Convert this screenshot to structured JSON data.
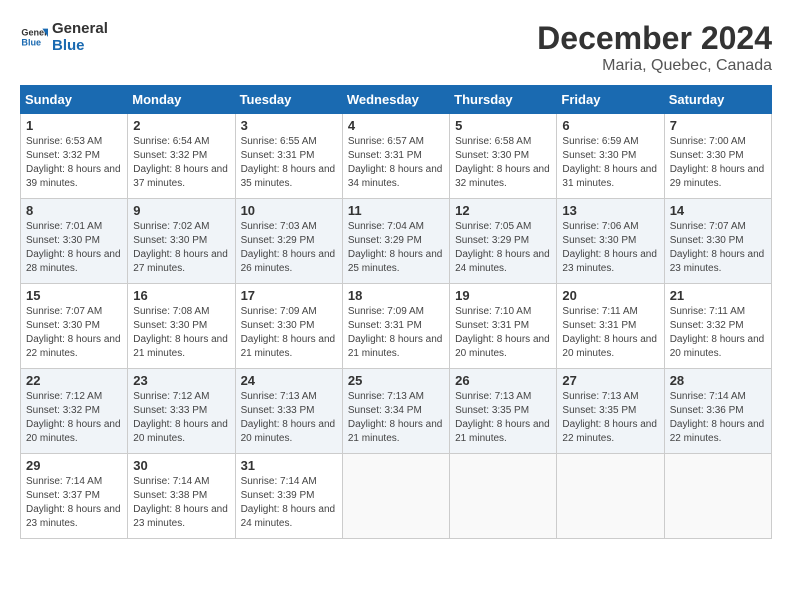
{
  "header": {
    "logo_general": "General",
    "logo_blue": "Blue",
    "month": "December 2024",
    "location": "Maria, Quebec, Canada"
  },
  "days_of_week": [
    "Sunday",
    "Monday",
    "Tuesday",
    "Wednesday",
    "Thursday",
    "Friday",
    "Saturday"
  ],
  "weeks": [
    [
      {
        "day": "1",
        "sunrise": "6:53 AM",
        "sunset": "3:32 PM",
        "daylight": "8 hours and 39 minutes."
      },
      {
        "day": "2",
        "sunrise": "6:54 AM",
        "sunset": "3:32 PM",
        "daylight": "8 hours and 37 minutes."
      },
      {
        "day": "3",
        "sunrise": "6:55 AM",
        "sunset": "3:31 PM",
        "daylight": "8 hours and 35 minutes."
      },
      {
        "day": "4",
        "sunrise": "6:57 AM",
        "sunset": "3:31 PM",
        "daylight": "8 hours and 34 minutes."
      },
      {
        "day": "5",
        "sunrise": "6:58 AM",
        "sunset": "3:30 PM",
        "daylight": "8 hours and 32 minutes."
      },
      {
        "day": "6",
        "sunrise": "6:59 AM",
        "sunset": "3:30 PM",
        "daylight": "8 hours and 31 minutes."
      },
      {
        "day": "7",
        "sunrise": "7:00 AM",
        "sunset": "3:30 PM",
        "daylight": "8 hours and 29 minutes."
      }
    ],
    [
      {
        "day": "8",
        "sunrise": "7:01 AM",
        "sunset": "3:30 PM",
        "daylight": "8 hours and 28 minutes."
      },
      {
        "day": "9",
        "sunrise": "7:02 AM",
        "sunset": "3:30 PM",
        "daylight": "8 hours and 27 minutes."
      },
      {
        "day": "10",
        "sunrise": "7:03 AM",
        "sunset": "3:29 PM",
        "daylight": "8 hours and 26 minutes."
      },
      {
        "day": "11",
        "sunrise": "7:04 AM",
        "sunset": "3:29 PM",
        "daylight": "8 hours and 25 minutes."
      },
      {
        "day": "12",
        "sunrise": "7:05 AM",
        "sunset": "3:29 PM",
        "daylight": "8 hours and 24 minutes."
      },
      {
        "day": "13",
        "sunrise": "7:06 AM",
        "sunset": "3:30 PM",
        "daylight": "8 hours and 23 minutes."
      },
      {
        "day": "14",
        "sunrise": "7:07 AM",
        "sunset": "3:30 PM",
        "daylight": "8 hours and 23 minutes."
      }
    ],
    [
      {
        "day": "15",
        "sunrise": "7:07 AM",
        "sunset": "3:30 PM",
        "daylight": "8 hours and 22 minutes."
      },
      {
        "day": "16",
        "sunrise": "7:08 AM",
        "sunset": "3:30 PM",
        "daylight": "8 hours and 21 minutes."
      },
      {
        "day": "17",
        "sunrise": "7:09 AM",
        "sunset": "3:30 PM",
        "daylight": "8 hours and 21 minutes."
      },
      {
        "day": "18",
        "sunrise": "7:09 AM",
        "sunset": "3:31 PM",
        "daylight": "8 hours and 21 minutes."
      },
      {
        "day": "19",
        "sunrise": "7:10 AM",
        "sunset": "3:31 PM",
        "daylight": "8 hours and 20 minutes."
      },
      {
        "day": "20",
        "sunrise": "7:11 AM",
        "sunset": "3:31 PM",
        "daylight": "8 hours and 20 minutes."
      },
      {
        "day": "21",
        "sunrise": "7:11 AM",
        "sunset": "3:32 PM",
        "daylight": "8 hours and 20 minutes."
      }
    ],
    [
      {
        "day": "22",
        "sunrise": "7:12 AM",
        "sunset": "3:32 PM",
        "daylight": "8 hours and 20 minutes."
      },
      {
        "day": "23",
        "sunrise": "7:12 AM",
        "sunset": "3:33 PM",
        "daylight": "8 hours and 20 minutes."
      },
      {
        "day": "24",
        "sunrise": "7:13 AM",
        "sunset": "3:33 PM",
        "daylight": "8 hours and 20 minutes."
      },
      {
        "day": "25",
        "sunrise": "7:13 AM",
        "sunset": "3:34 PM",
        "daylight": "8 hours and 21 minutes."
      },
      {
        "day": "26",
        "sunrise": "7:13 AM",
        "sunset": "3:35 PM",
        "daylight": "8 hours and 21 minutes."
      },
      {
        "day": "27",
        "sunrise": "7:13 AM",
        "sunset": "3:35 PM",
        "daylight": "8 hours and 22 minutes."
      },
      {
        "day": "28",
        "sunrise": "7:14 AM",
        "sunset": "3:36 PM",
        "daylight": "8 hours and 22 minutes."
      }
    ],
    [
      {
        "day": "29",
        "sunrise": "7:14 AM",
        "sunset": "3:37 PM",
        "daylight": "8 hours and 23 minutes."
      },
      {
        "day": "30",
        "sunrise": "7:14 AM",
        "sunset": "3:38 PM",
        "daylight": "8 hours and 23 minutes."
      },
      {
        "day": "31",
        "sunrise": "7:14 AM",
        "sunset": "3:39 PM",
        "daylight": "8 hours and 24 minutes."
      },
      null,
      null,
      null,
      null
    ]
  ],
  "labels": {
    "sunrise": "Sunrise:",
    "sunset": "Sunset:",
    "daylight": "Daylight hours"
  }
}
